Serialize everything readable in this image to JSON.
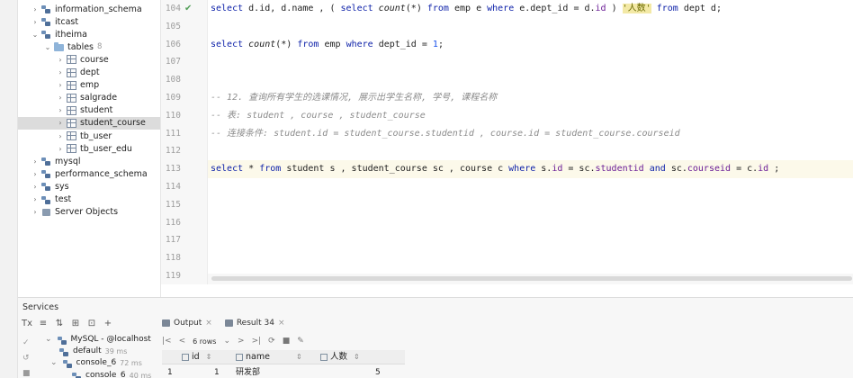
{
  "tree": {
    "items": [
      {
        "label": "information_schema",
        "icon": "schema-icon",
        "arrow": "›",
        "count": ""
      },
      {
        "label": "itcast",
        "icon": "schema-icon",
        "arrow": "›",
        "count": ""
      },
      {
        "label": "itheima",
        "icon": "schema-icon",
        "arrow": "⌄",
        "count": ""
      },
      {
        "label": "tables",
        "icon": "folder-icon",
        "arrow": "⌄",
        "count": "8"
      },
      {
        "label": "course",
        "icon": "table-icon",
        "arrow": "›",
        "count": ""
      },
      {
        "label": "dept",
        "icon": "table-icon",
        "arrow": "›",
        "count": ""
      },
      {
        "label": "emp",
        "icon": "table-icon",
        "arrow": "›",
        "count": ""
      },
      {
        "label": "salgrade",
        "icon": "table-icon",
        "arrow": "›",
        "count": ""
      },
      {
        "label": "student",
        "icon": "table-icon",
        "arrow": "›",
        "count": ""
      },
      {
        "label": "student_course",
        "icon": "table-icon",
        "arrow": "›",
        "count": ""
      },
      {
        "label": "tb_user",
        "icon": "table-icon",
        "arrow": "›",
        "count": ""
      },
      {
        "label": "tb_user_edu",
        "icon": "table-icon",
        "arrow": "›",
        "count": ""
      },
      {
        "label": "mysql",
        "icon": "schema-icon",
        "arrow": "›",
        "count": ""
      },
      {
        "label": "performance_schema",
        "icon": "schema-icon",
        "arrow": "›",
        "count": ""
      },
      {
        "label": "sys",
        "icon": "schema-icon",
        "arrow": "›",
        "count": ""
      },
      {
        "label": "test",
        "icon": "schema-icon",
        "arrow": "›",
        "count": ""
      },
      {
        "label": "Server Objects",
        "icon": "server-icon",
        "arrow": "›",
        "count": ""
      }
    ],
    "selected": "student_course"
  },
  "editor": {
    "line_numbers": [
      "104",
      "105",
      "106",
      "107",
      "108",
      "109",
      "110",
      "111",
      "112",
      "113",
      "114",
      "115",
      "116",
      "117",
      "118",
      "119"
    ],
    "check_mark": "✔",
    "lines": [
      [
        [
          "kw",
          "select "
        ],
        [
          "plain",
          "d.id, d.name , ( "
        ],
        [
          "kw",
          "select "
        ],
        [
          "fn",
          "count"
        ],
        [
          "plain",
          "(*) "
        ],
        [
          "kw",
          "from "
        ],
        [
          "plain",
          "emp e "
        ],
        [
          "kw",
          "where "
        ],
        [
          "plain",
          "e.dept_id = d."
        ],
        [
          "col",
          "id"
        ],
        [
          "plain",
          " ) "
        ],
        [
          "alias",
          "'人数'"
        ],
        [
          "plain",
          " "
        ],
        [
          "kw",
          "from "
        ],
        [
          "plain",
          "dept d;"
        ]
      ],
      [],
      [
        [
          "kw",
          "select "
        ],
        [
          "fn",
          "count"
        ],
        [
          "plain",
          "(*) "
        ],
        [
          "kw",
          "from "
        ],
        [
          "plain",
          "emp "
        ],
        [
          "kw",
          "where "
        ],
        [
          "plain",
          "dept_id = "
        ],
        [
          "num",
          "1"
        ],
        [
          "plain",
          ";"
        ]
      ],
      [],
      [],
      [
        [
          "cm",
          "-- 12. 查询所有学生的选课情况, 展示出学生名称, 学号, 课程名称"
        ]
      ],
      [
        [
          "cm",
          "-- 表: student , course , student_course"
        ]
      ],
      [
        [
          "cm",
          "-- 连接条件: student.id = student_course.studentid , course.id = student_course.courseid"
        ]
      ],
      [],
      [
        [
          "kw",
          "select "
        ],
        [
          "plain",
          "* "
        ],
        [
          "kw",
          "from "
        ],
        [
          "plain",
          "student s , student_course sc , course c "
        ],
        [
          "kw",
          "where "
        ],
        [
          "plain",
          "s."
        ],
        [
          "col",
          "id"
        ],
        [
          "plain",
          " = sc."
        ],
        [
          "col",
          "studentid"
        ],
        [
          "plain",
          " "
        ],
        [
          "kw",
          "and "
        ],
        [
          "plain",
          "sc."
        ],
        [
          "col",
          "courseid"
        ],
        [
          "plain",
          " = c."
        ],
        [
          "col",
          "id"
        ],
        [
          "plain",
          " ;"
        ]
      ],
      [],
      [],
      [],
      [],
      [],
      []
    ]
  },
  "services": {
    "title": "Services",
    "toolbar_icons": [
      "Tx",
      "≡",
      "⇅",
      "⊞",
      "⊡",
      "+"
    ],
    "tree": [
      {
        "label": "MySQL - @localhost",
        "ms": "",
        "arrow": "⌄"
      },
      {
        "label": "default",
        "ms": "39 ms",
        "arrow": ""
      },
      {
        "label": "console_6",
        "ms": "72 ms",
        "arrow": "⌄"
      },
      {
        "label": "console_6",
        "ms": "40 ms",
        "arrow": ""
      }
    ],
    "tabs": [
      {
        "label": "Output",
        "close": "×"
      },
      {
        "label": "Result 34",
        "close": "×"
      }
    ],
    "result_toolbar": {
      "first": "|<",
      "prev": "<",
      "rows": "6 rows",
      "dropdown": "⌄",
      "next": ">",
      "last": ">|",
      "refresh": "⟳",
      "stop": "■",
      "pin": "✎"
    },
    "grid": {
      "columns": [
        "id",
        "name",
        "人数"
      ],
      "rows": [
        {
          "num": "1",
          "id": "1",
          "name": "研发部",
          "count": "5"
        }
      ]
    }
  }
}
